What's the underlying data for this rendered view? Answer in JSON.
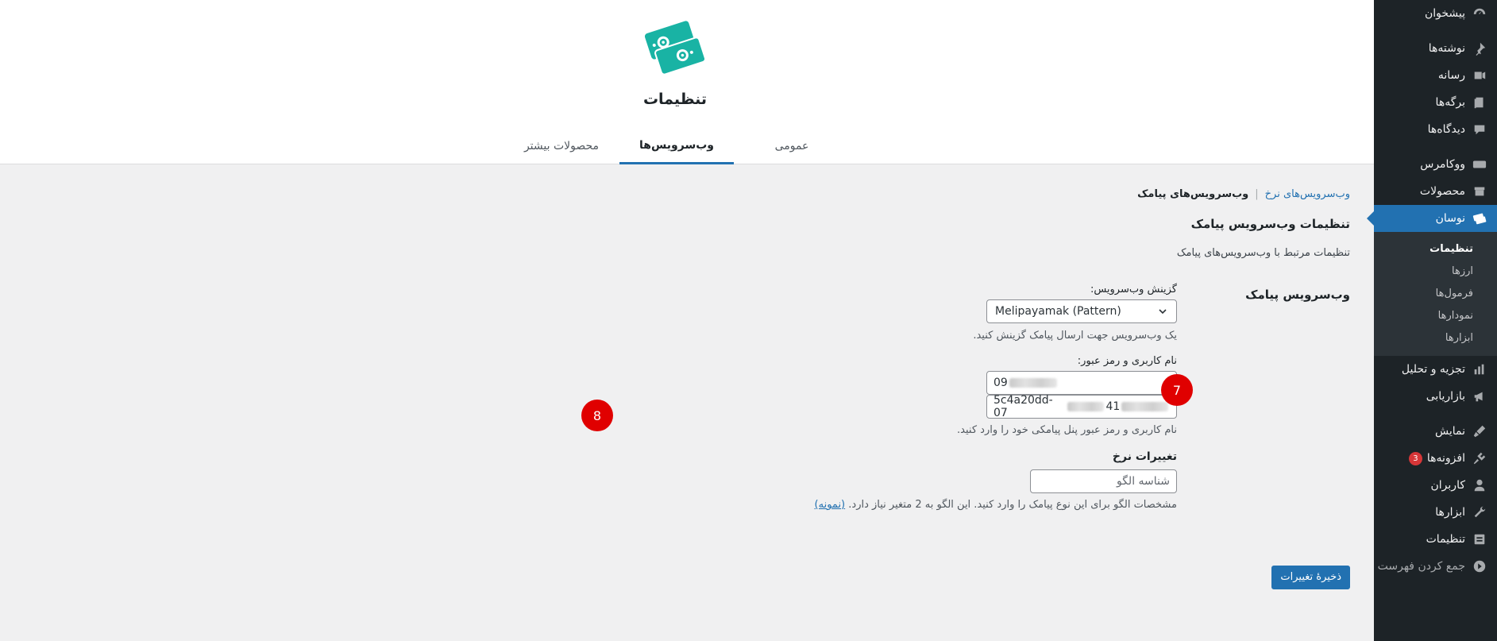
{
  "sidebar": {
    "items": [
      {
        "label": "پیشخوان",
        "icon": "dashboard-icon"
      },
      {
        "label": "نوشته‌ها",
        "icon": "pin-icon"
      },
      {
        "label": "رسانه",
        "icon": "media-icon"
      },
      {
        "label": "برگه‌ها",
        "icon": "pages-icon"
      },
      {
        "label": "دیدگاه‌ها",
        "icon": "comments-icon"
      },
      {
        "label": "ووکامرس",
        "icon": "woo-icon"
      },
      {
        "label": "محصولات",
        "icon": "products-icon"
      },
      {
        "label": "نوسان",
        "icon": "navasan-icon"
      },
      {
        "label": "تجزیه و تحلیل",
        "icon": "analytics-icon"
      },
      {
        "label": "بازاریابی",
        "icon": "megaphone-icon"
      },
      {
        "label": "نمایش",
        "icon": "appearance-icon"
      },
      {
        "label": "افزونه‌ها",
        "icon": "plugins-icon",
        "badge": "3"
      },
      {
        "label": "کاربران",
        "icon": "users-icon"
      },
      {
        "label": "ابزارها",
        "icon": "tools-icon"
      },
      {
        "label": "تنظیمات",
        "icon": "settings-icon"
      },
      {
        "label": "جمع کردن فهرست",
        "icon": "collapse-icon"
      }
    ],
    "submenu": [
      "تنظیمات",
      "ارزها",
      "فرمول‌ها",
      "نمودارها",
      "ابزارها"
    ]
  },
  "header": {
    "title": "تنظیمات",
    "tabs": [
      "عمومی",
      "وب‌سرویس‌ها",
      "محصولات بیشتر"
    ]
  },
  "content": {
    "subnav": {
      "link": "وب‌سرویس‌های نرخ",
      "separator": "|",
      "current": "وب‌سرویس‌های پیامک"
    },
    "section_title": "تنظیمات وب‌سرویس پیامک",
    "section_desc": "تنظیمات مرتبط با وب‌سرویس‌های پیامک",
    "row_label": "وب‌سرویس پیامک",
    "webservice": {
      "label": "گزینش وب‌سرویس:",
      "value": "Melipayamak (Pattern)",
      "desc": "یک وب‌سرویس جهت ارسال پیامک گزینش کنید."
    },
    "credentials": {
      "label": "نام کاربری و رمز عبور:",
      "username_prefix": "09",
      "password_prefix": "5c4a20dd-07",
      "password_mid": "41",
      "desc": "نام کاربری و رمز عبور پنل پیامکی خود را وارد کنید."
    },
    "markers": [
      "7",
      "8"
    ],
    "rate_changes": {
      "label": "تغییرات نرخ",
      "placeholder": "شناسه الگو",
      "desc": "مشخصات الگو برای این نوع پیامک را وارد کنید. این الگو به 2 متغیر نیاز دارد.",
      "link": "(نمونه)"
    },
    "save_label": "ذخیرهٔ تغییرات"
  }
}
